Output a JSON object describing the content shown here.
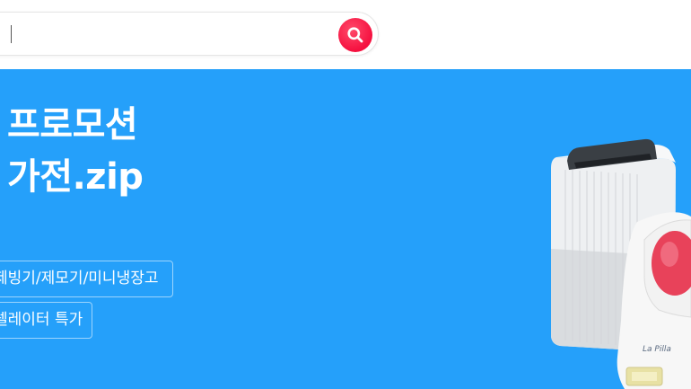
{
  "search": {
    "value": "",
    "placeholder": "",
    "button_icon": "search-icon",
    "button_color": "#f5103f"
  },
  "banner": {
    "background_color": "#25a0fa",
    "headline_line1": "프로모션",
    "headline_line2": "가전.zip",
    "chips": [
      {
        "label": "제빙기/제모기/미니냉장고"
      },
      {
        "label": "렐레이터 특가"
      }
    ],
    "product_brand_text": "La Pilla"
  }
}
